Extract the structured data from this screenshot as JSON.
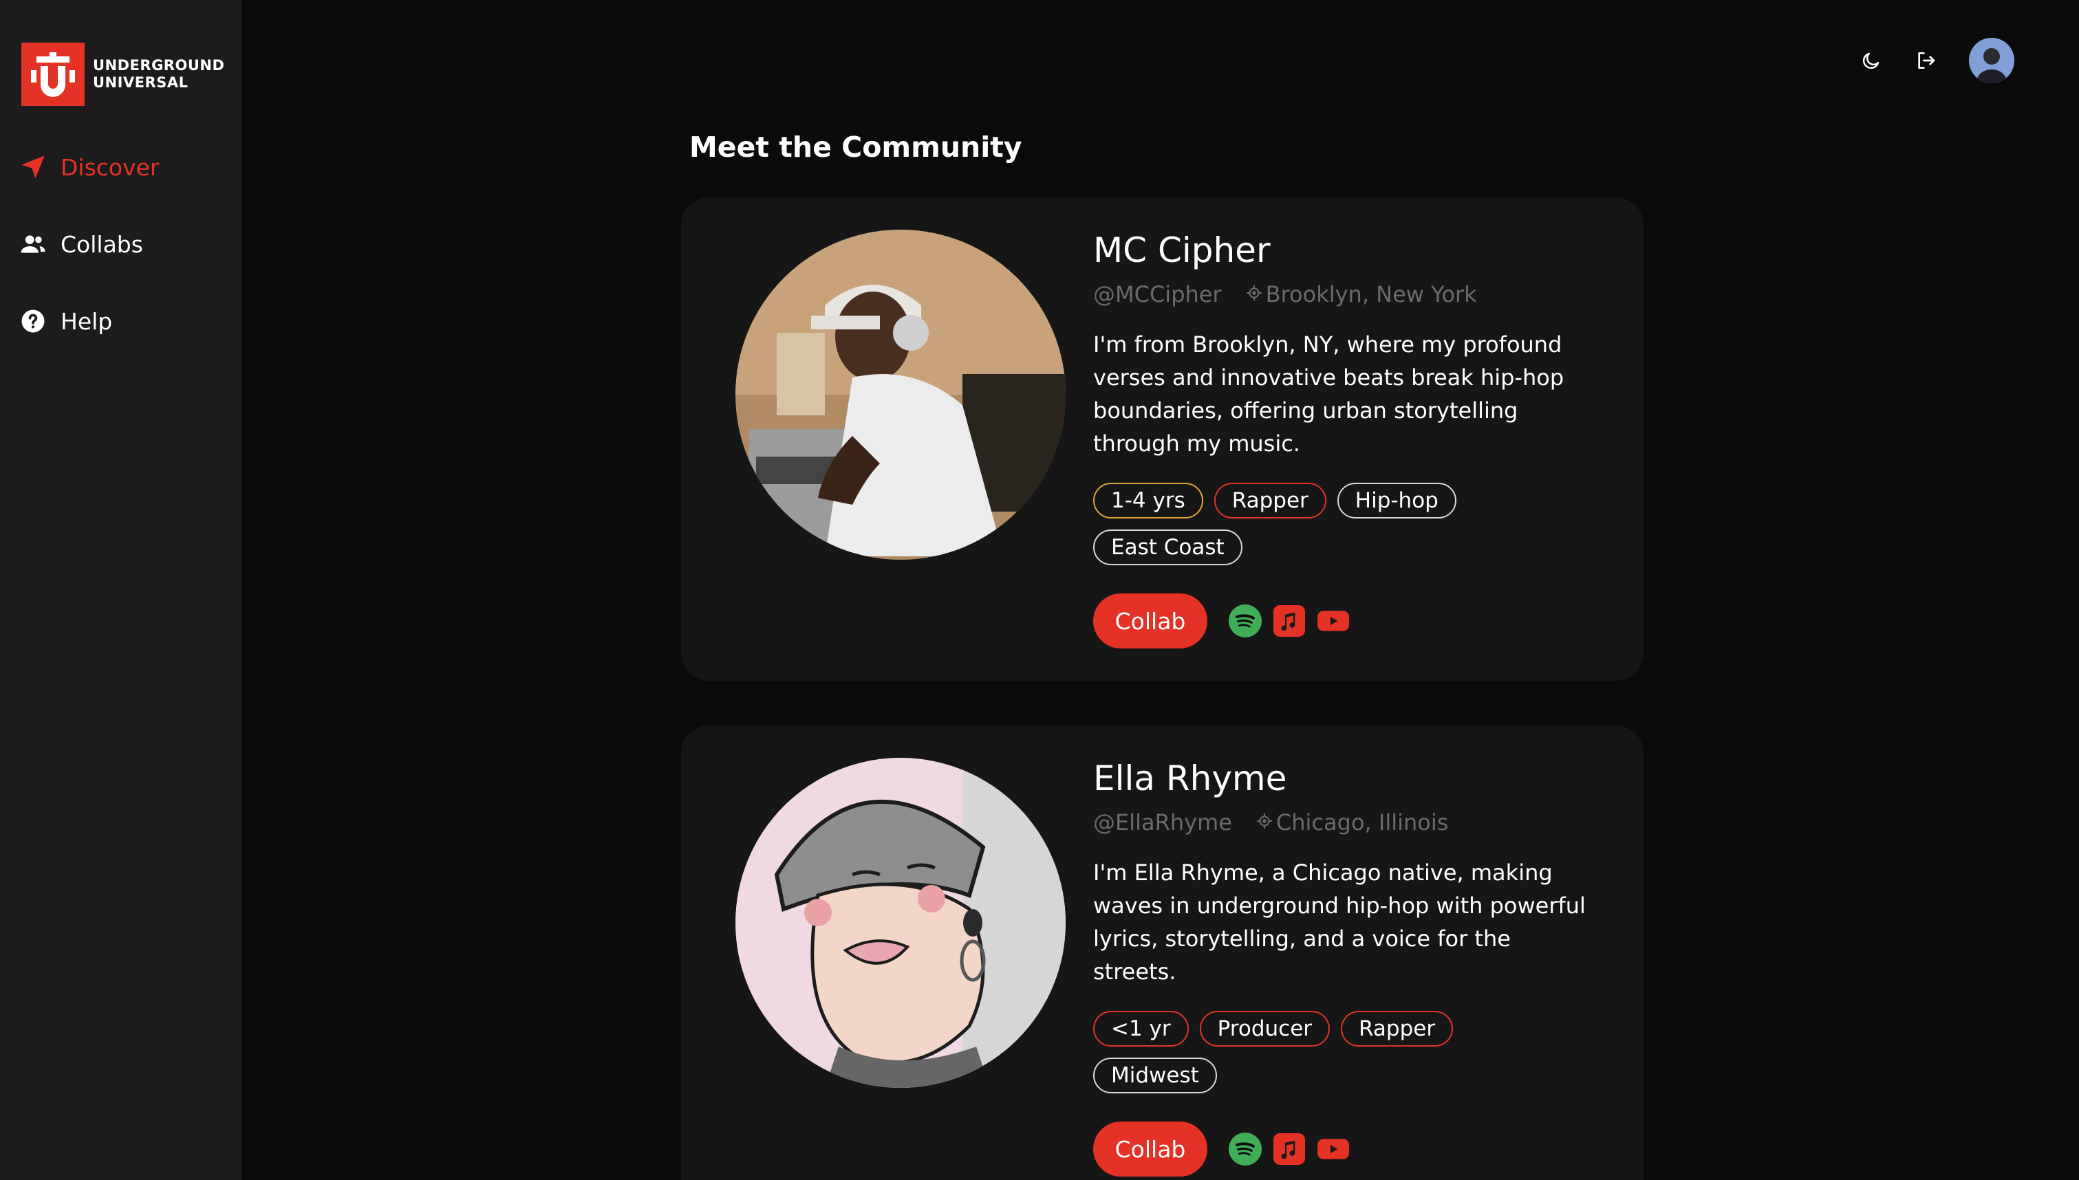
{
  "brand": {
    "line1": "UNDERGROUND",
    "line2": "UNIVERSAL",
    "accent": "#e53227"
  },
  "sidebar": {
    "items": [
      {
        "label": "Discover",
        "icon": "send-icon",
        "active": true
      },
      {
        "label": "Collabs",
        "icon": "users-icon",
        "active": false
      },
      {
        "label": "Help",
        "icon": "help-icon",
        "active": false
      }
    ]
  },
  "topbar": {
    "icons": [
      "moon-icon",
      "logout-icon",
      "user-avatar"
    ]
  },
  "main": {
    "title": "Meet the Community",
    "cards": [
      {
        "name": "MC Cipher",
        "handle": "@MCCipher",
        "location": "Brooklyn, New York",
        "bio": "I'm from Brooklyn, NY, where my profound verses and innovative beats break hip-hop boundaries, offering urban storytelling through my music.",
        "tags": [
          {
            "label": "1-4 yrs",
            "kind": "exp"
          },
          {
            "label": "Rapper",
            "kind": "role"
          },
          {
            "label": "Hip-hop",
            "kind": "genre"
          },
          {
            "label": "East Coast",
            "kind": "genre"
          }
        ],
        "action_label": "Collab",
        "social": [
          "spotify-icon",
          "apple-music-icon",
          "youtube-icon"
        ]
      },
      {
        "name": "Ella Rhyme",
        "handle": "@EllaRhyme",
        "location": "Chicago, Illinois",
        "bio": "I'm Ella Rhyme, a Chicago native, making waves in underground hip-hop with powerful lyrics, storytelling, and a voice for the streets.",
        "tags": [
          {
            "label": "<1 yr",
            "kind": "exp"
          },
          {
            "label": "Producer",
            "kind": "role"
          },
          {
            "label": "Rapper",
            "kind": "role"
          },
          {
            "label": "Midwest",
            "kind": "genre"
          }
        ],
        "action_label": "Collab",
        "social": [
          "spotify-icon",
          "apple-music-icon",
          "youtube-icon"
        ]
      }
    ]
  }
}
